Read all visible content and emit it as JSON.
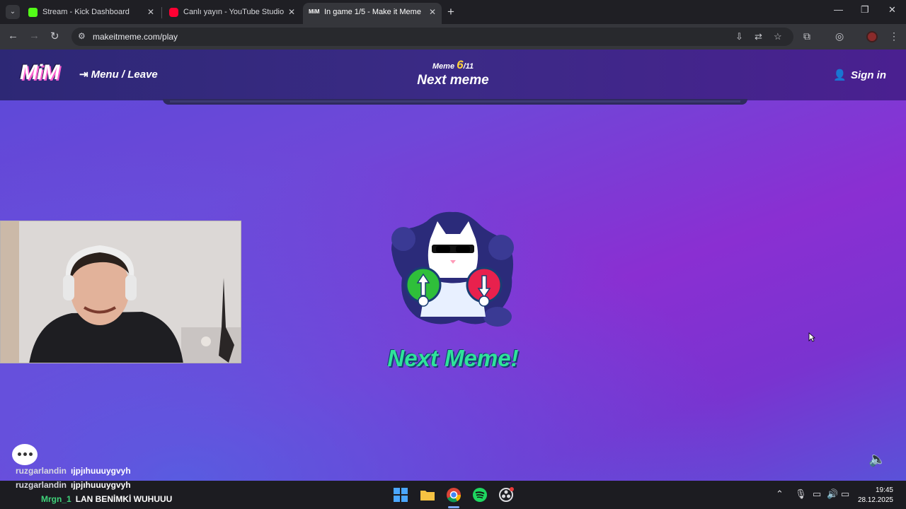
{
  "browser": {
    "tabs": [
      {
        "title": "Stream - Kick Dashboard",
        "favicon_color": "#53fc18",
        "active": false
      },
      {
        "title": "Canlı yayın - YouTube Studio",
        "favicon_color": "#ff0033",
        "active": false
      },
      {
        "title": "In game 1/5 - Make it Meme",
        "favicon_text": "MiM",
        "active": true
      }
    ],
    "url": "makeitmeme.com/play",
    "icons": {
      "tab_search": "chevron-down-icon",
      "new_tab": "plus-icon",
      "back": "arrow-left-icon",
      "forward": "arrow-right-icon",
      "reload": "reload-icon"
    }
  },
  "game": {
    "logo": "MiM",
    "menu_leave": "Menu / Leave",
    "meme_label": "Meme",
    "meme_current": "6",
    "meme_total": "/11",
    "header_title": "Next meme",
    "sign_in": "Sign in",
    "next_meme": "Next Meme!",
    "colors": {
      "accent_green": "#2fe39a",
      "counter_yellow": "#ffd23a",
      "up_button": "#2fbf3a",
      "down_button": "#e8214d"
    }
  },
  "chat": {
    "messages": [
      {
        "user": "ruzgarlandin",
        "text": "ıjpjıhuuuygvyh"
      },
      {
        "user": "ruzgarlandin",
        "text": "ıjpjıhuuuygvyh"
      },
      {
        "user": "Mrgn_1",
        "text": "LAN BENİMKİ WUHUUU"
      }
    ]
  },
  "taskbar": {
    "time": "19:45",
    "date": "28.12.2025"
  }
}
